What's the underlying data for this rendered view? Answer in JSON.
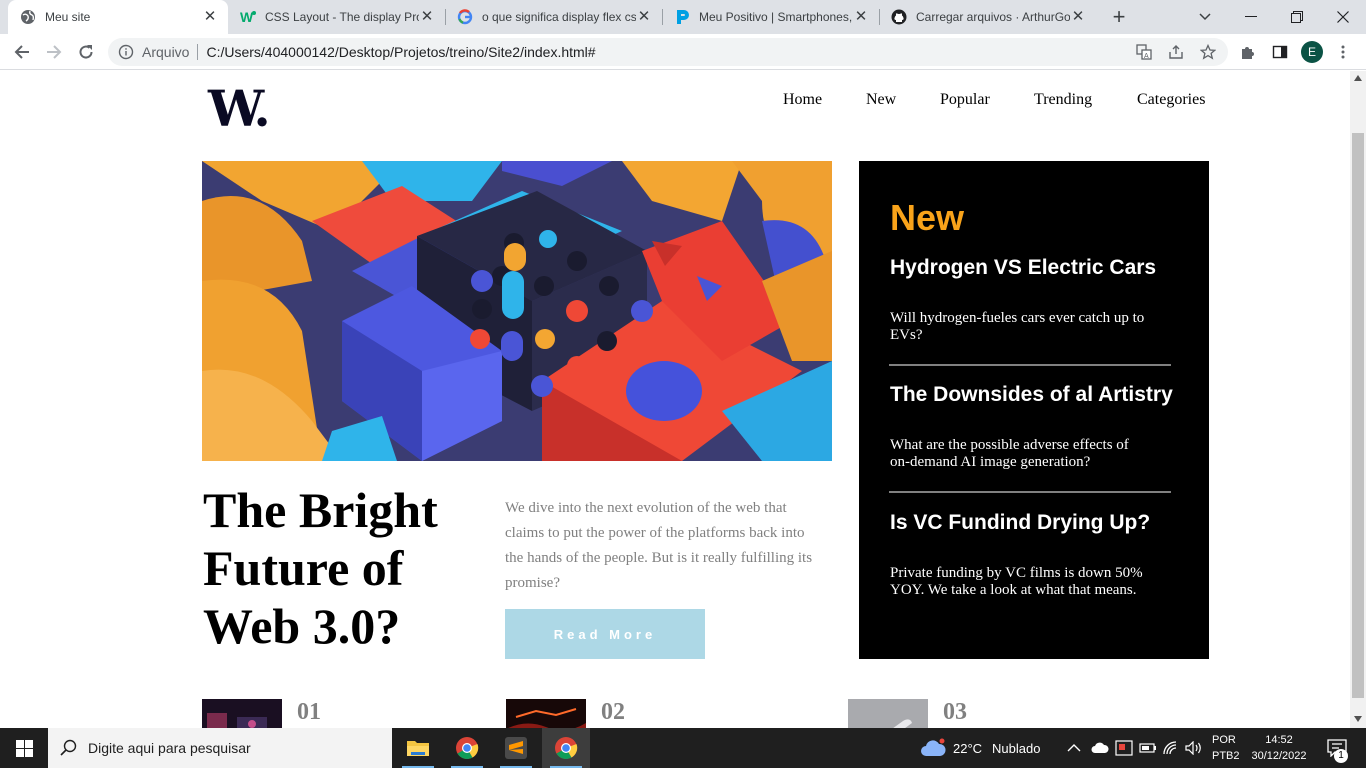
{
  "browser": {
    "tabs": [
      {
        "title": "Meu site",
        "icon": "globe-icon",
        "active": true
      },
      {
        "title": "CSS Layout - The display Prop",
        "icon": "w3schools-icon",
        "active": false
      },
      {
        "title": "o que significa display flex css",
        "icon": "google-icon",
        "active": false
      },
      {
        "title": "Meu Positivo | Smartphones,",
        "icon": "positivo-icon",
        "active": false
      },
      {
        "title": "Carregar arquivos · ArthurGo",
        "icon": "github-icon",
        "active": false
      }
    ],
    "new_tab_symbol": "+",
    "address": {
      "security_label": "Arquivo",
      "url": "C:/Users/404000142/Desktop/Projetos/treino/Site2/index.html#"
    },
    "profile_initial": "E"
  },
  "site": {
    "logo": "W.",
    "nav": [
      "Home",
      "New",
      "Popular",
      "Trending",
      "Categories"
    ],
    "headline": "The Bright Future of Web 3.0?",
    "intro": "We dive into the next evolution of the web that claims to put the power of the platforms back into the hands of the people. But is it really fulfilling its promise?",
    "read_more": "Read More",
    "new_panel": {
      "heading": "New",
      "items": [
        {
          "title": "Hydrogen VS Electric Cars",
          "desc": "Will hydrogen-fueles cars ever catch up to EVs?"
        },
        {
          "title": "The Downsides of al Artistry",
          "desc": "What are the possible adverse effects of on-demand AI image generation?"
        },
        {
          "title": "Is VC Fundind Drying Up?",
          "desc": "Private funding by VC films is down 50% YOY. We take a look at what that means."
        }
      ]
    },
    "numbers": [
      "01",
      "02",
      "03"
    ],
    "accent_color": "#f9a31a",
    "button_color": "#add8e6"
  },
  "taskbar": {
    "search_placeholder": "Digite aqui para pesquisar",
    "weather": {
      "temp": "22°C",
      "condition": "Nublado"
    },
    "language": {
      "line1": "POR",
      "line2": "PTB2"
    },
    "clock": {
      "time": "14:52",
      "date": "30/12/2022"
    },
    "notification_count": "1"
  }
}
